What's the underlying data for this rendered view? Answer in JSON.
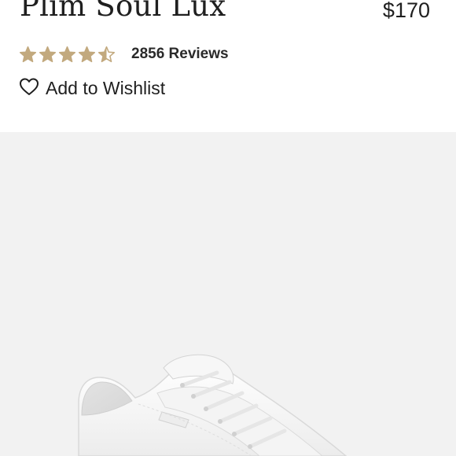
{
  "product": {
    "title": "Plim Soul Lux",
    "price": "$170",
    "rating": 4.5,
    "rating_max": 5,
    "reviews_label": "2856 Reviews",
    "wishlist_label": "Add to Wishlist"
  },
  "colors": {
    "star": "#c2a97e",
    "text": "#1f1f1f",
    "image_bg": "#f2f2f2"
  },
  "icons": {
    "wishlist": "heart-outline-icon",
    "star": "star-icon"
  }
}
